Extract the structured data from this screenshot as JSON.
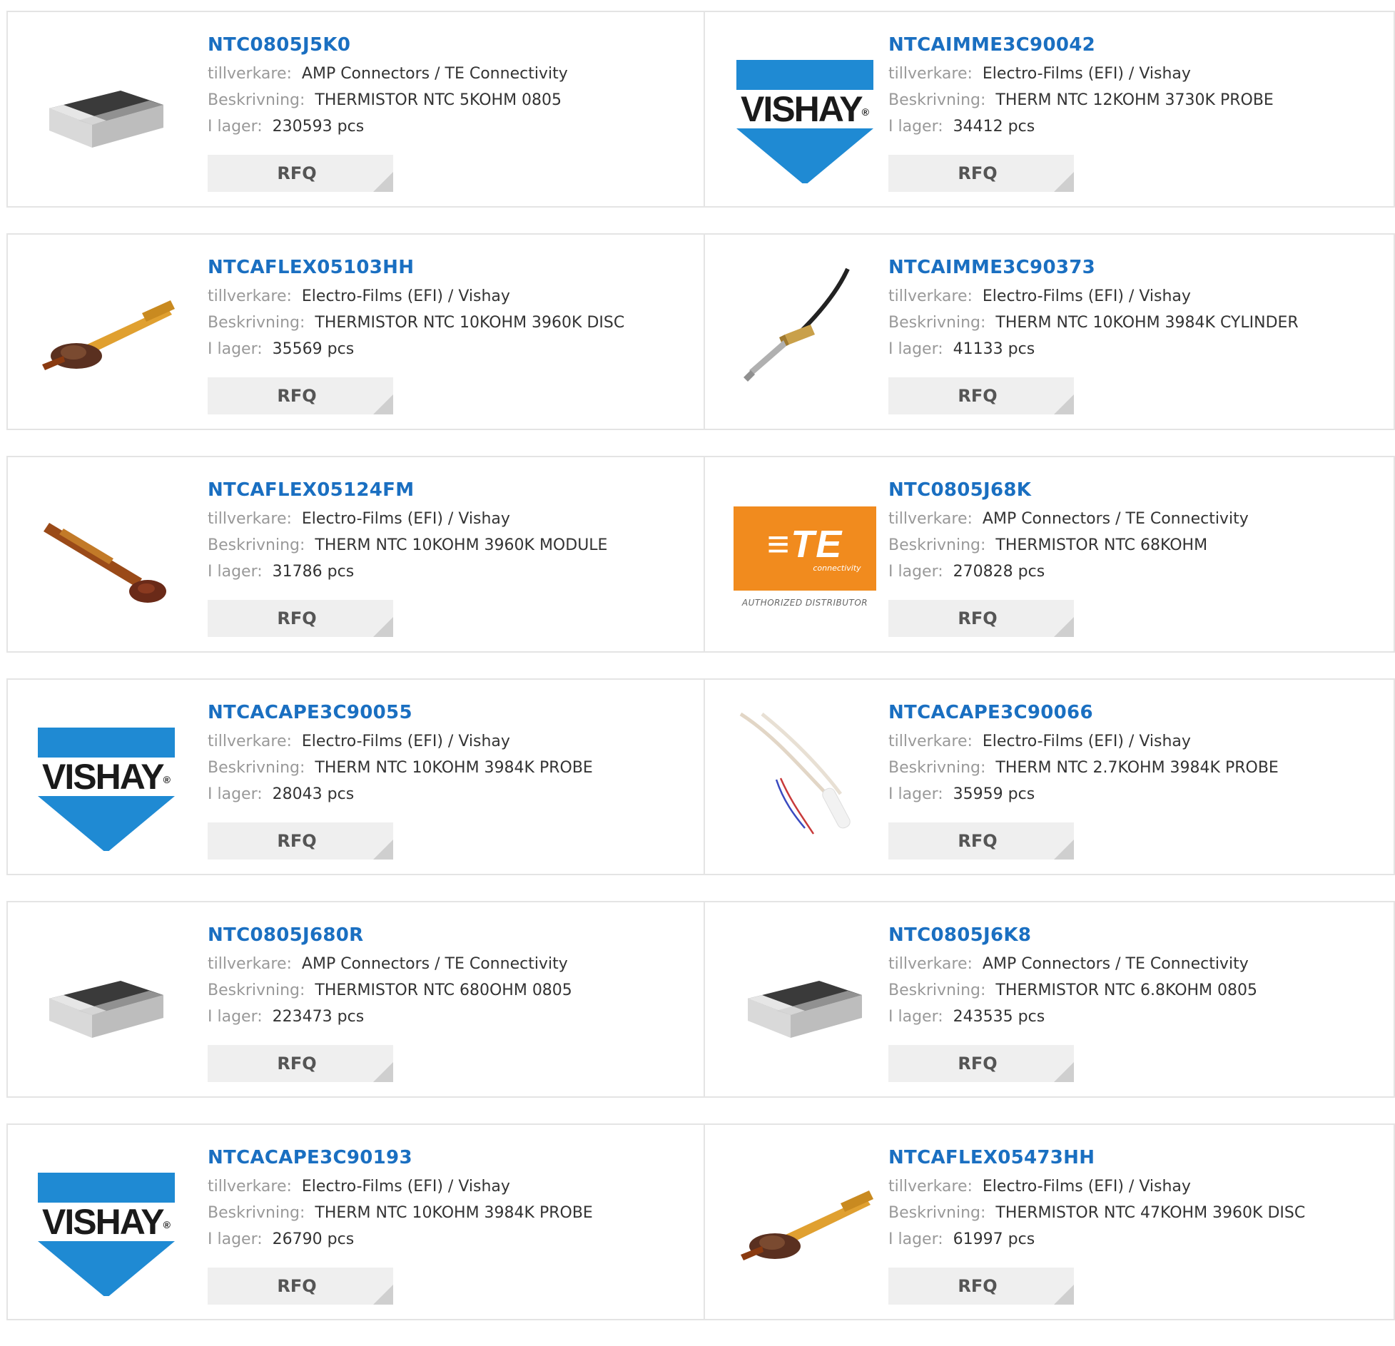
{
  "labels": {
    "manufacturer": "tillverkare:",
    "description": "Beskrivning:",
    "stock": "I lager:",
    "rfq": "RFQ"
  },
  "logo_text": {
    "vishay": "VISHAY",
    "vishay_reg": "®",
    "te_mark": "≡TE",
    "te_sub": "connectivity",
    "te_dist": "AUTHORIZED DISTRIBUTOR"
  },
  "colors": {
    "link": "#1a6fc1",
    "vishay_blue": "#1f8ad3",
    "te_orange": "#f18b1e"
  },
  "products": [
    {
      "part": "NTC0805J5K0",
      "manufacturer": "AMP Connectors / TE Connectivity",
      "description": "THERMISTOR NTC 5KOHM 0805",
      "stock": "230593 pcs",
      "image": "smd-chip"
    },
    {
      "part": "NTCAIMME3C90042",
      "manufacturer": "Electro-Films (EFI) / Vishay",
      "description": "THERM NTC 12KOHM 3730K PROBE",
      "stock": "34412 pcs",
      "image": "vishay-logo"
    },
    {
      "part": "NTCAFLEX05103HH",
      "manufacturer": "Electro-Films (EFI) / Vishay",
      "description": "THERMISTOR NTC 10KOHM 3960K DISC",
      "stock": "35569 pcs",
      "image": "flex-sensor"
    },
    {
      "part": "NTCAIMME3C90373",
      "manufacturer": "Electro-Films (EFI) / Vishay",
      "description": "THERM NTC 10KOHM 3984K CYLINDER",
      "stock": "41133 pcs",
      "image": "cylinder-probe"
    },
    {
      "part": "NTCAFLEX05124FM",
      "manufacturer": "Electro-Films (EFI) / Vishay",
      "description": "THERM NTC 10KOHM 3960K MODULE",
      "stock": "31786 pcs",
      "image": "flex-module"
    },
    {
      "part": "NTC0805J68K",
      "manufacturer": "AMP Connectors / TE Connectivity",
      "description": "THERMISTOR NTC 68KOHM",
      "stock": "270828 pcs",
      "image": "te-logo"
    },
    {
      "part": "NTCACAPE3C90055",
      "manufacturer": "Electro-Films (EFI) / Vishay",
      "description": "THERM NTC 10KOHM 3984K PROBE",
      "stock": "28043 pcs",
      "image": "vishay-logo"
    },
    {
      "part": "NTCACAPE3C90066",
      "manufacturer": "Electro-Films (EFI) / Vishay",
      "description": "THERM NTC 2.7KOHM 3984K PROBE",
      "stock": "35959 pcs",
      "image": "wire-probe"
    },
    {
      "part": "NTC0805J680R",
      "manufacturer": "AMP Connectors / TE Connectivity",
      "description": "THERMISTOR NTC 680OHM 0805",
      "stock": "223473 pcs",
      "image": "smd-chip"
    },
    {
      "part": "NTC0805J6K8",
      "manufacturer": "AMP Connectors / TE Connectivity",
      "description": "THERMISTOR NTC 6.8KOHM 0805",
      "stock": "243535 pcs",
      "image": "smd-chip"
    },
    {
      "part": "NTCACAPE3C90193",
      "manufacturer": "Electro-Films (EFI) / Vishay",
      "description": "THERM NTC 10KOHM 3984K PROBE",
      "stock": "26790 pcs",
      "image": "vishay-logo"
    },
    {
      "part": "NTCAFLEX05473HH",
      "manufacturer": "Electro-Films (EFI) / Vishay",
      "description": "THERMISTOR NTC 47KOHM 3960K DISC",
      "stock": "61997 pcs",
      "image": "flex-sensor"
    }
  ]
}
